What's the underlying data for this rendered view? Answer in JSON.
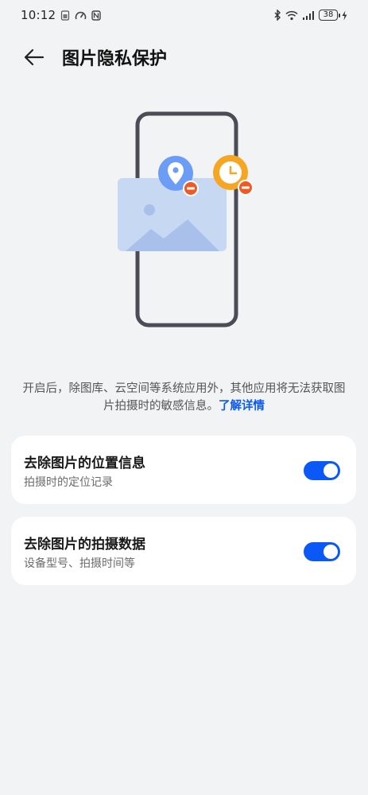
{
  "status_bar": {
    "time": "10:12",
    "battery": "38"
  },
  "header": {
    "title": "图片隐私保护"
  },
  "description": {
    "text": "开启后，除图库、云空间等系统应用外，其他应用将无法获取图片拍摄时的敏感信息。",
    "link": "了解详情"
  },
  "settings": [
    {
      "title": "去除图片的位置信息",
      "subtitle": "拍摄时的定位记录",
      "enabled": true
    },
    {
      "title": "去除图片的拍摄数据",
      "subtitle": "设备型号、拍摄时间等",
      "enabled": true
    }
  ],
  "colors": {
    "accent": "#0a59f7",
    "background": "#f1f3f5",
    "card": "#ffffff",
    "location_badge": "#6b9cf6",
    "time_badge": "#f5a623",
    "remove_badge": "#ef5a24"
  }
}
